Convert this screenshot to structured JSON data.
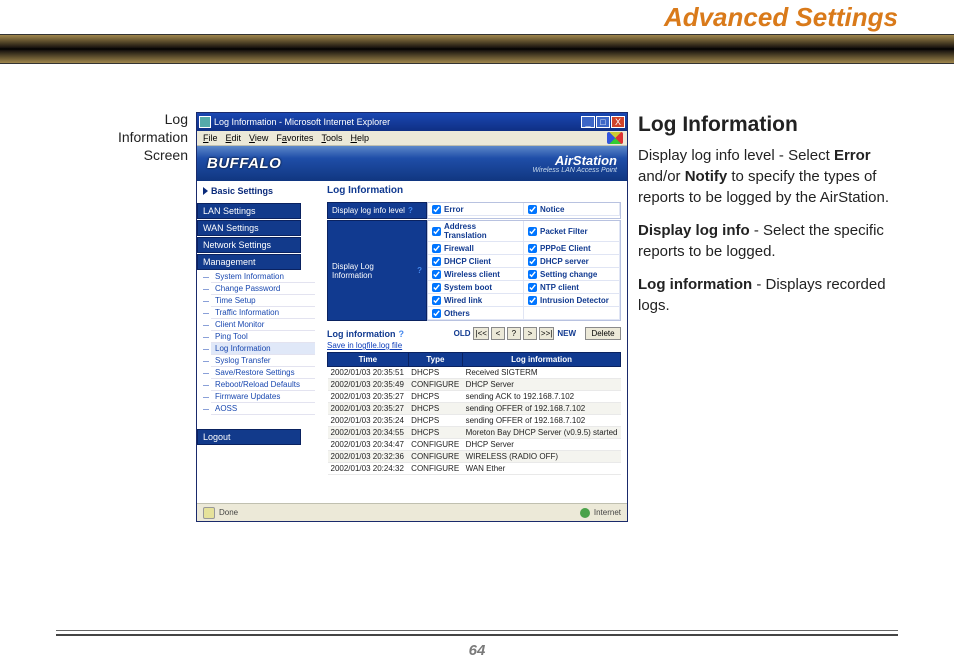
{
  "section_title": "Advanced Settings",
  "page_number": "64",
  "caption": "Log Information Screen",
  "explain": {
    "heading": "Log Information",
    "p1a": "Display log info level - Select ",
    "p1b1": "Error",
    "p1c": " and/or ",
    "p1b2": "Notify",
    "p1d": " to specify the types of reports to be logged by the AirStation.",
    "p2b": "Display log info",
    "p2r": " - Select the specific reports to be logged.",
    "p3b": "Log information",
    "p3r": " - Displays recorded logs."
  },
  "window": {
    "title": "Log Information - Microsoft Internet Explorer",
    "controls": {
      "min": "_",
      "max": "□",
      "close": "X"
    },
    "menu": {
      "file": "File",
      "edit": "Edit",
      "view": "View",
      "favorites": "Favorites",
      "tools": "Tools",
      "help": "Help"
    },
    "brand": "BUFFALO",
    "airstation_title": "AirStation",
    "airstation_sub": "Wireless LAN Access Point",
    "basic_settings": "Basic Settings",
    "nav": {
      "lan": "LAN Settings",
      "wan": "WAN Settings",
      "net": "Network Settings",
      "mgmt": "Management",
      "sub": [
        "System Information",
        "Change Password",
        "Time Setup",
        "Traffic Information",
        "Client Monitor",
        "Ping Tool",
        "Log Information",
        "Syslog Transfer",
        "Save/Restore Settings",
        "Reboot/Reload Defaults",
        "Firmware Updates",
        "AOSS"
      ],
      "logout": "Logout"
    },
    "main_title": "Log Information",
    "level_label": "Display log info level",
    "info_label": "Display Log Information",
    "q": "?",
    "level_opts": [
      "Error",
      "Notice"
    ],
    "info_opts": [
      [
        "Address Translation",
        "Packet Filter"
      ],
      [
        "Firewall",
        "PPPoE Client"
      ],
      [
        "DHCP Client",
        "DHCP server"
      ],
      [
        "Wireless client",
        "Setting change"
      ],
      [
        "System boot",
        "NTP client"
      ],
      [
        "Wired link",
        "Intrusion Detector"
      ],
      [
        "Others",
        ""
      ]
    ],
    "loginfo_label": "Log information",
    "save_link": "Save in logfile.log file",
    "pager": {
      "old": "OLD",
      "first": "|<<",
      "prev": "<",
      "page": "?",
      "next": ">",
      "last": ">>|",
      "new": "NEW",
      "delete": "Delete"
    },
    "table": {
      "headers": [
        "Time",
        "Type",
        "Log information"
      ],
      "rows": [
        [
          "2002/01/03 20:35:51",
          "DHCPS",
          "Received SIGTERM"
        ],
        [
          "2002/01/03 20:35:49",
          "CONFIGURE",
          "DHCP Server"
        ],
        [
          "2002/01/03 20:35:27",
          "DHCPS",
          "sending ACK to 192.168.7.102"
        ],
        [
          "2002/01/03 20:35:27",
          "DHCPS",
          "sending OFFER of 192.168.7.102"
        ],
        [
          "2002/01/03 20:35:24",
          "DHCPS",
          "sending OFFER of 192.168.7.102"
        ],
        [
          "2002/01/03 20:34:55",
          "DHCPS",
          "Moreton Bay DHCP Server (v0.9.5) started"
        ],
        [
          "2002/01/03 20:34:47",
          "CONFIGURE",
          "DHCP Server"
        ],
        [
          "2002/01/03 20:32:36",
          "CONFIGURE",
          "WIRELESS (RADIO OFF)"
        ],
        [
          "2002/01/03 20:24:32",
          "CONFIGURE",
          "WAN Ether"
        ]
      ]
    },
    "status_done": "Done",
    "status_zone": "Internet"
  }
}
